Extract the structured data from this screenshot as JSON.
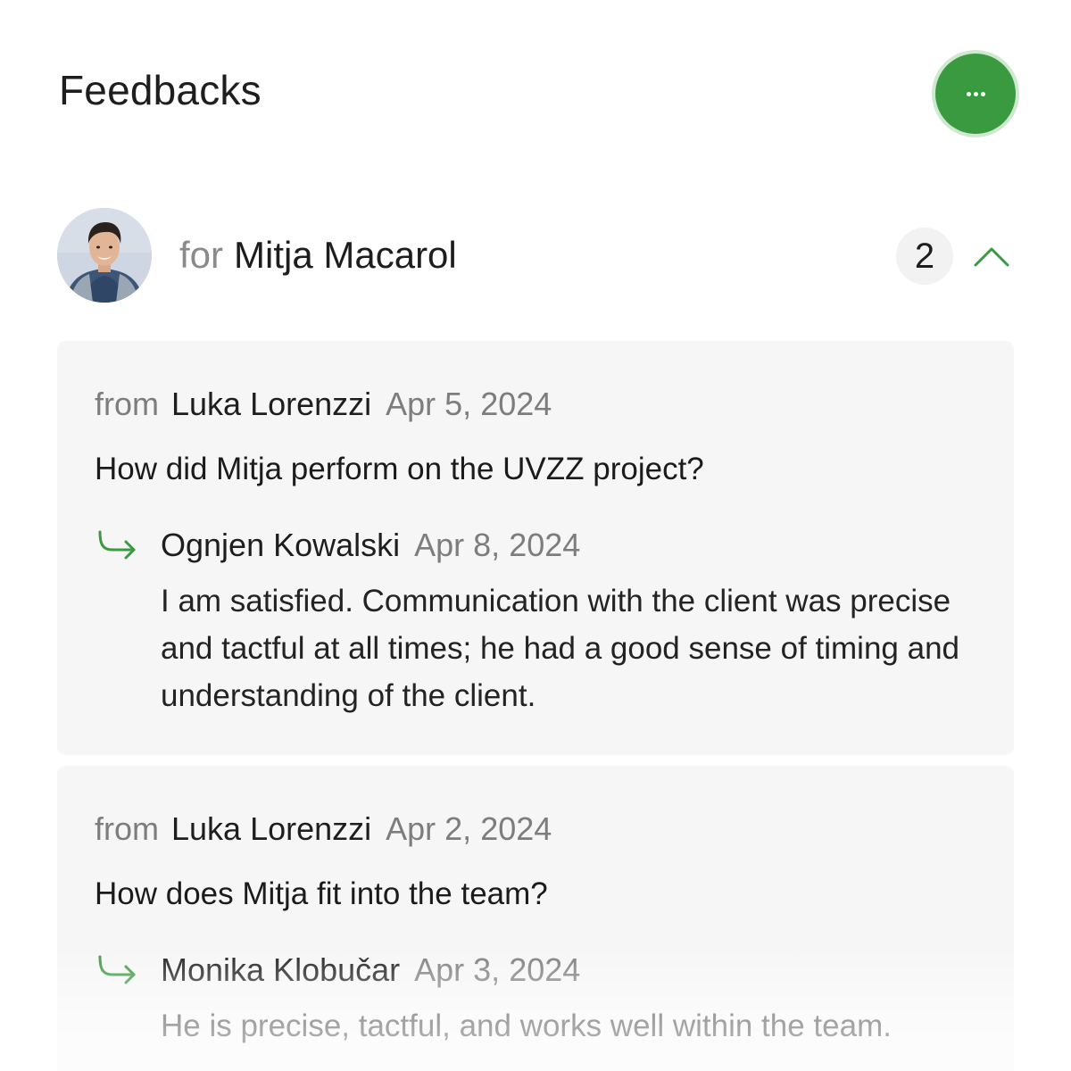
{
  "header": {
    "title": "Feedbacks",
    "more_button_label": "···",
    "more_icon": "more-horizontal-icon",
    "accent_color": "#3a9a3f"
  },
  "recipient": {
    "prefix": "for",
    "name": "Mitja Macarol",
    "feedback_count": "2",
    "avatar_icon": "person-avatar",
    "collapse_icon": "chevron-up-icon"
  },
  "feedbacks": [
    {
      "from_prefix": "from",
      "author": "Luka Lorenzzi",
      "date": "Apr 5, 2024",
      "question": "How did Mitja perform on the UVZZ project?",
      "reply": {
        "icon": "reply-arrow-icon",
        "responder": "Ognjen Kowalski",
        "date": "Apr 8, 2024",
        "text": "I am satisfied. Communication with the client was precise and tactful at all times; he had a good sense of timing and understanding of the client."
      }
    },
    {
      "from_prefix": "from",
      "author": "Luka Lorenzzi",
      "date": "Apr 2, 2024",
      "question": "How does Mitja fit into the team?",
      "reply": {
        "icon": "reply-arrow-icon",
        "responder": "Monika Klobučar",
        "date": "Apr 3, 2024",
        "text": "He is precise, tactful, and works well within the team."
      }
    }
  ]
}
